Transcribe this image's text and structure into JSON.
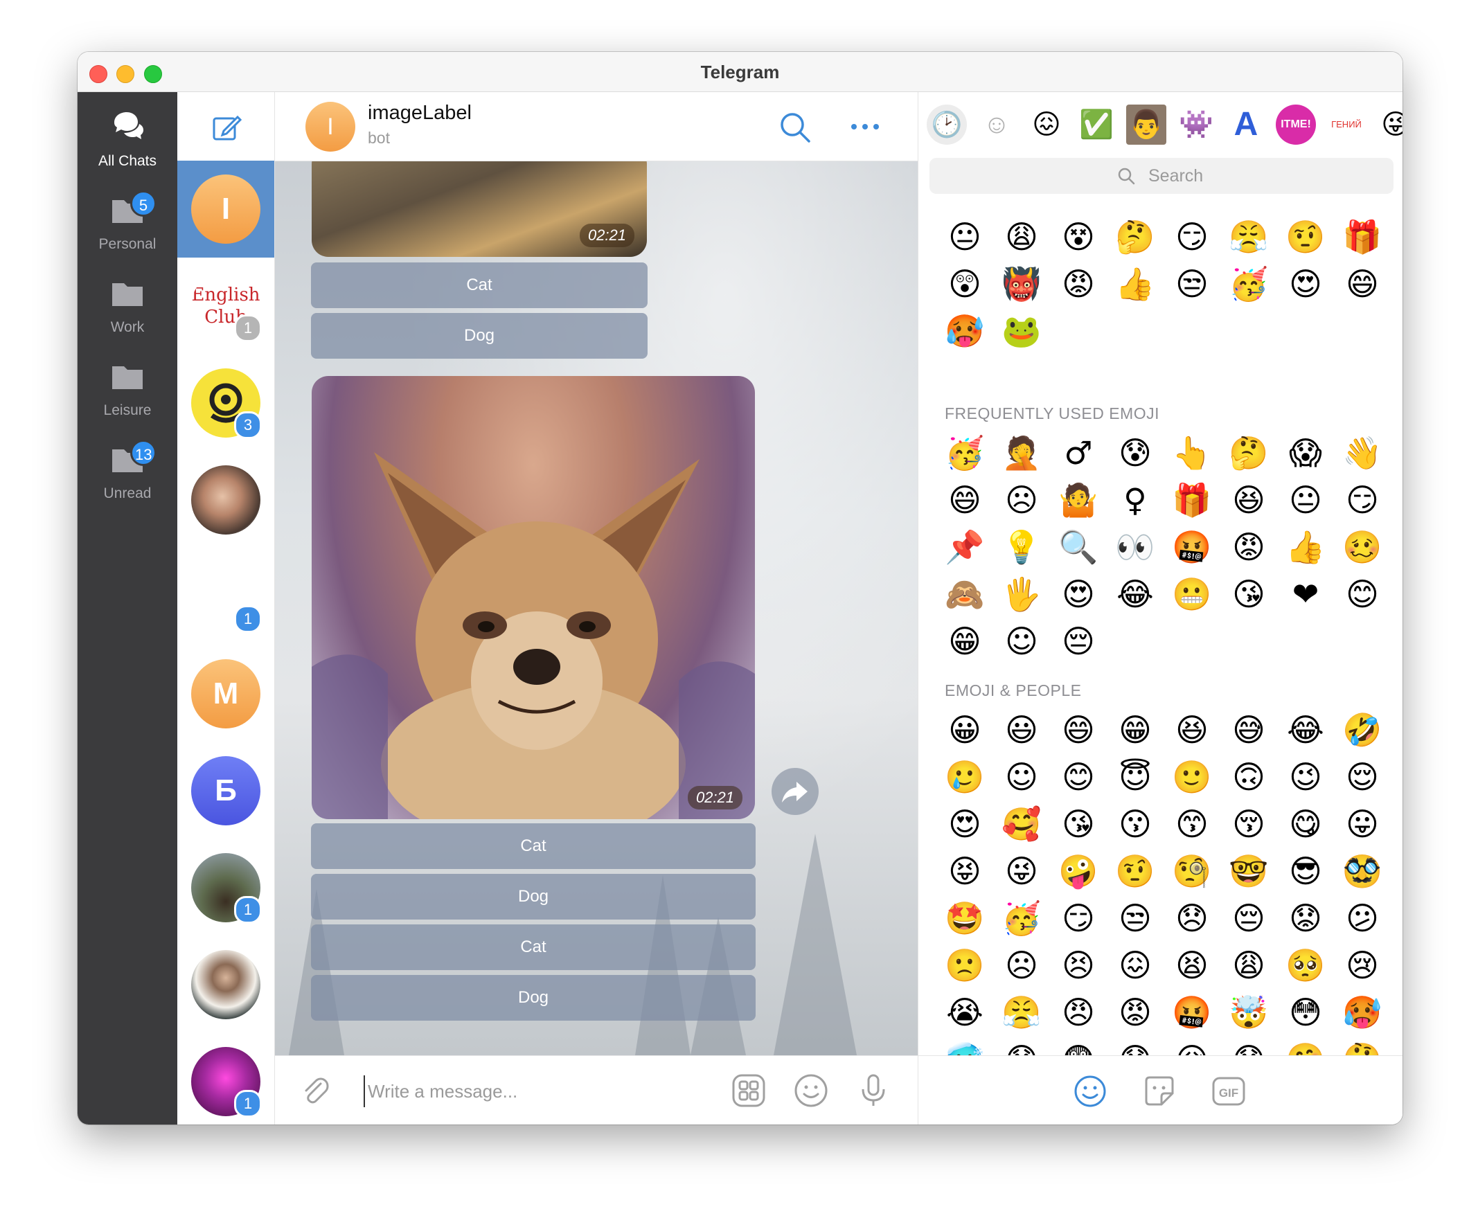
{
  "window": {
    "title": "Telegram"
  },
  "folders": [
    {
      "label": "All Chats",
      "icon": "chats-icon",
      "badge": "",
      "active": true
    },
    {
      "label": "Personal",
      "icon": "folder-icon",
      "badge": "5"
    },
    {
      "label": "Work",
      "icon": "folder-icon",
      "badge": ""
    },
    {
      "label": "Leisure",
      "icon": "folder-icon",
      "badge": ""
    },
    {
      "label": "Unread",
      "icon": "folder-icon",
      "badge": "13"
    }
  ],
  "chats": [
    {
      "initial": "I",
      "badge": "",
      "color": "#f5a048",
      "active": true
    },
    {
      "initial": "",
      "badge": "1",
      "logo": "English Club",
      "muted": true
    },
    {
      "initial": "",
      "badge": "3",
      "color": "#f6e23a"
    },
    {
      "initial": "",
      "badge": "",
      "color": "#8a6b5a"
    },
    {
      "initial": "",
      "badge": "1",
      "color": "#e8e2da"
    },
    {
      "initial": "М",
      "badge": "",
      "color": "#f5a048"
    },
    {
      "initial": "Б",
      "badge": "",
      "color": "#5b6cf0"
    },
    {
      "initial": "",
      "badge": "1",
      "color": "#5e6b4e"
    },
    {
      "initial": "",
      "badge": "",
      "color": "#2e3a3a"
    },
    {
      "initial": "",
      "badge": "1",
      "color": "#8a2a8a"
    }
  ],
  "header": {
    "avatar_initial": "I",
    "name": "imageLabel",
    "subtitle": "bot"
  },
  "messages": {
    "first": {
      "time": "02:21",
      "buttons": [
        "Cat",
        "Dog"
      ]
    },
    "second": {
      "time": "02:21",
      "buttons": [
        "Cat",
        "Dog",
        "Cat",
        "Dog"
      ]
    }
  },
  "composer": {
    "placeholder": "Write a message..."
  },
  "emoji_panel": {
    "search_placeholder": "Search",
    "sticker_tabs": [
      "🕑",
      "☺",
      "😖",
      "✅",
      "👨",
      "👾",
      "A",
      "ITME!",
      "ГЕНИЙ",
      "😜"
    ],
    "recent_stickers": [
      "😐",
      "😩",
      "😵",
      "🤔",
      "😏",
      "😤",
      "🤨",
      "🎁",
      "😲",
      "👹",
      "😡",
      "👍",
      "😒",
      "🥳",
      "😍",
      "😄",
      "🥵",
      "🐸"
    ],
    "frequent_title": "FREQUENTLY USED EMOJI",
    "frequent": [
      "🥳",
      "🤦",
      "♂",
      "😰",
      "👆",
      "🤔",
      "😱",
      "👋",
      "😄",
      "☹",
      "🤷",
      "♀",
      "🎁",
      "😆",
      "😐",
      "😏",
      "📌",
      "💡",
      "🔍",
      "👀",
      "🤬",
      "😡",
      "👍",
      "🥴",
      "🙈",
      "🖐",
      "😍",
      "😂",
      "😬",
      "😘",
      "❤",
      "😊",
      "😁",
      "☺",
      "😔"
    ],
    "people_title": "EMOJI & PEOPLE",
    "people": [
      "😀",
      "😃",
      "😄",
      "😁",
      "😆",
      "😅",
      "😂",
      "🤣",
      "🥲",
      "☺",
      "😊",
      "😇",
      "🙂",
      "🙃",
      "😉",
      "😌",
      "😍",
      "🥰",
      "😘",
      "😗",
      "😙",
      "😚",
      "😋",
      "😛",
      "😝",
      "😜",
      "🤪",
      "🤨",
      "🧐",
      "🤓",
      "😎",
      "🥸",
      "🤩",
      "🥳",
      "😏",
      "😒",
      "😞",
      "😔",
      "😟",
      "😕",
      "🙁",
      "☹",
      "😣",
      "😖",
      "😫",
      "😩",
      "🥺",
      "😢",
      "😭",
      "😤",
      "😠",
      "😡",
      "🤬",
      "🤯",
      "😳",
      "🥵",
      "🥶",
      "😱",
      "😨",
      "😰",
      "😥",
      "😓",
      "🤗",
      "🤔",
      "🤭",
      "🤫",
      "🤥",
      "😶",
      "😐",
      "😑",
      "😬",
      "🙄"
    ],
    "footer": [
      "smile-icon",
      "sticker-icon",
      "gif-icon"
    ],
    "footer_gif": "GIF"
  }
}
